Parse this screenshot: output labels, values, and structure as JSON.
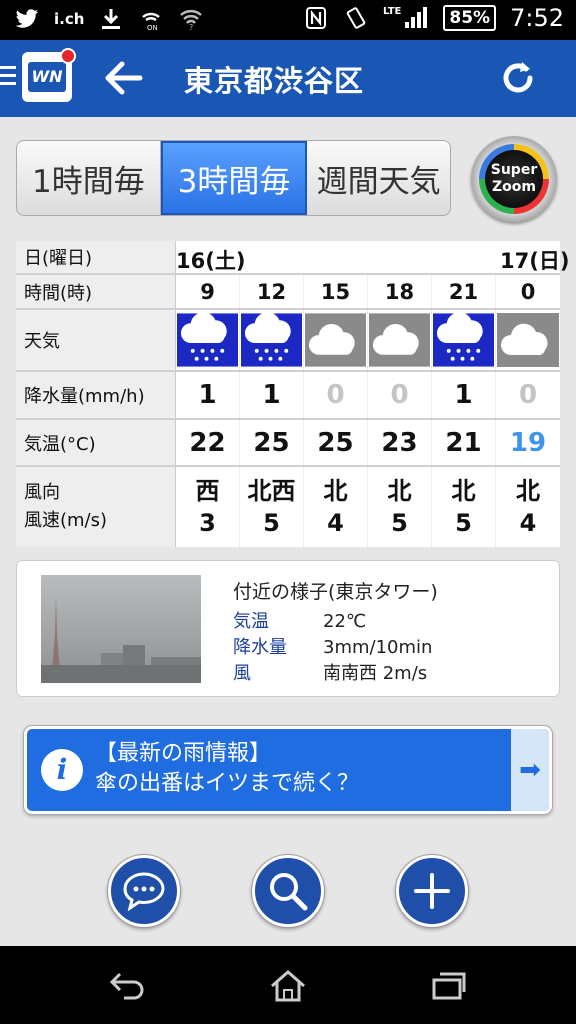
{
  "status_bar": {
    "carrier_tag": "i.ch",
    "network": "LTE",
    "battery": "85%",
    "time": "7:52",
    "icons": [
      "twitter-icon",
      "download-icon",
      "wifi-calling-icon",
      "wifi-icon",
      "nfc-icon",
      "vibrate-icon",
      "signal-icon",
      "battery-icon"
    ]
  },
  "header": {
    "title": "東京都渋谷区",
    "logo_text": "WN",
    "brand_color": "#1a57b5"
  },
  "tabs": [
    {
      "label": "1時間毎",
      "active": false
    },
    {
      "label": "3時間毎",
      "active": true
    },
    {
      "label": "週間天気",
      "active": false
    }
  ],
  "super_zoom": {
    "line1": "Super",
    "line2": "Zoom"
  },
  "forecast": {
    "row_labels": {
      "day": "日(曜日)",
      "time": "時間(時)",
      "weather": "天気",
      "rain": "降水量(mm/h)",
      "temp": "気温(°C)",
      "wind_dir": "風向",
      "wind_speed": "風速(m/s)"
    },
    "days": [
      {
        "label": "16(土)",
        "col": 0
      },
      {
        "label": "17(日)",
        "col": 5
      }
    ],
    "hours": [
      "9",
      "12",
      "15",
      "18",
      "21",
      "0"
    ],
    "weather": [
      "rain",
      "rain",
      "cloudy",
      "cloudy",
      "rain",
      "cloudy"
    ],
    "rain": [
      "1",
      "1",
      "0",
      "0",
      "1",
      "0"
    ],
    "temp": [
      "22",
      "25",
      "25",
      "23",
      "21",
      "19"
    ],
    "wind_dir": [
      "西",
      "北西",
      "北",
      "北",
      "北",
      "北"
    ],
    "wind_speed": [
      "3",
      "5",
      "4",
      "5",
      "5",
      "4"
    ]
  },
  "nearby": {
    "title": "付近の様子(東京タワー)",
    "rows": [
      {
        "label": "気温",
        "value": "22℃"
      },
      {
        "label": "降水量",
        "value": "3mm/10min"
      },
      {
        "label": "風",
        "value": "南南西 2m/s"
      }
    ]
  },
  "banner": {
    "line1": "【最新の雨情報】",
    "line2": "傘の出番はイツまで続く？"
  },
  "actions": [
    "chat-icon",
    "search-icon",
    "plus-icon"
  ]
}
